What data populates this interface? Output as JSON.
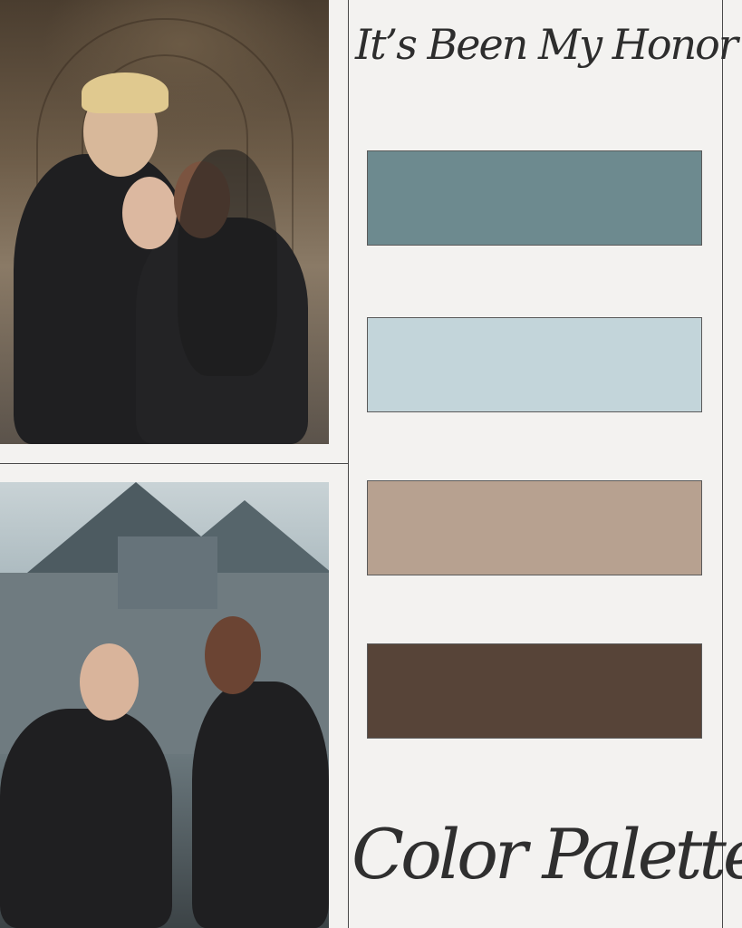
{
  "title_top": "It’s Been My Honor",
  "title_bottom": "Color Palette",
  "images": {
    "top": "three people in black leather jackets hugging in a stone arcade",
    "bottom": "two women in black fur-collared leather jackets in snow before a castle"
  },
  "palette": [
    {
      "hex": "#6d8a8f"
    },
    {
      "hex": "#c3d5da"
    },
    {
      "hex": "#b7a190"
    },
    {
      "hex": "#574438"
    }
  ]
}
